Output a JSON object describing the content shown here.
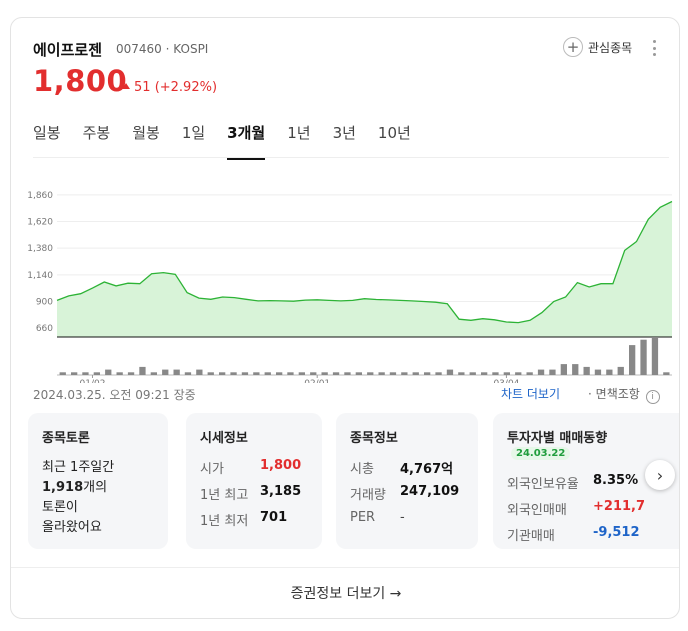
{
  "stock": {
    "name": "에이프로젠",
    "code": "007460",
    "market": "KOSPI",
    "dot": "·",
    "price": "1,800",
    "change": "51",
    "change_pct": "(+2.92%)",
    "favorite_label": "관심종목"
  },
  "tabs": [
    "일봉",
    "주봉",
    "월봉",
    "1일",
    "3개월",
    "1년",
    "3년",
    "10년"
  ],
  "active_tab": 4,
  "timestamp": "2024.03.25. 오전 09:21 장중",
  "links": {
    "chart_more": "차트 더보기",
    "separator": "·",
    "disclaimer": "면책조항",
    "info": "i"
  },
  "colors": {
    "up": "#e22e2e",
    "down": "#1e64c8",
    "line": "#2db336",
    "area": "#d8f3d8",
    "volume": "#888888"
  },
  "chart_data": {
    "type": "area",
    "y_ticks": [
      "1,860",
      "1,620",
      "1,380",
      "1,140",
      "900",
      "660"
    ],
    "y_tick_values": [
      1860,
      1620,
      1380,
      1140,
      900,
      660
    ],
    "ylim": [
      580,
      1940
    ],
    "x_labels": [
      "01/02",
      "02/01",
      "03/04"
    ],
    "x_label_index": [
      3,
      22,
      38
    ],
    "values": [
      910,
      950,
      970,
      1020,
      1075,
      1040,
      1065,
      1060,
      1150,
      1160,
      1145,
      980,
      930,
      920,
      940,
      935,
      920,
      905,
      908,
      905,
      902,
      912,
      915,
      910,
      905,
      910,
      925,
      918,
      914,
      910,
      905,
      900,
      893,
      880,
      740,
      730,
      745,
      735,
      715,
      710,
      730,
      800,
      900,
      940,
      1070,
      1030,
      1060,
      1060,
      1360,
      1440,
      1640,
      1748,
      1800
    ],
    "volume": [
      1,
      1,
      1,
      1,
      2,
      1,
      1,
      3,
      1,
      2,
      2,
      1,
      2,
      1,
      1,
      1,
      1,
      1,
      1,
      1,
      1,
      1,
      1,
      1,
      1,
      1,
      1,
      1,
      1,
      1,
      1,
      1,
      1,
      1,
      2,
      1,
      1,
      1,
      1,
      1,
      1,
      1,
      2,
      2,
      4,
      4,
      3,
      2,
      2,
      3,
      11,
      13,
      14,
      1
    ]
  },
  "tiles": {
    "discussion": {
      "title": "종목토론",
      "line1": "최근 1주일간",
      "count": "1,918",
      "count_suffix": "개의",
      "line3": "토론이",
      "line4": "올라왔어요"
    },
    "market": {
      "title": "시세정보",
      "rows": [
        {
          "k": "시가",
          "v": "1,800"
        },
        {
          "k": "1년 최고",
          "v": "3,185"
        },
        {
          "k": "1년 최저",
          "v": "701"
        }
      ]
    },
    "stockinfo": {
      "title": "종목정보",
      "rows": [
        {
          "k": "시총",
          "v": "4,767억"
        },
        {
          "k": "거래량",
          "v": "247,109"
        },
        {
          "k": "PER",
          "v": "-"
        }
      ]
    },
    "investor": {
      "title": "투자자별 매매동향",
      "date": "24.03.22",
      "rows": [
        {
          "k": "외국인보유율",
          "v": "8.35%"
        },
        {
          "k": "외국인매매",
          "v": "+211,7"
        },
        {
          "k": "기관매매",
          "v": "-9,512"
        }
      ]
    }
  },
  "next_arrow": "›",
  "footer": "증권정보 더보기 →"
}
